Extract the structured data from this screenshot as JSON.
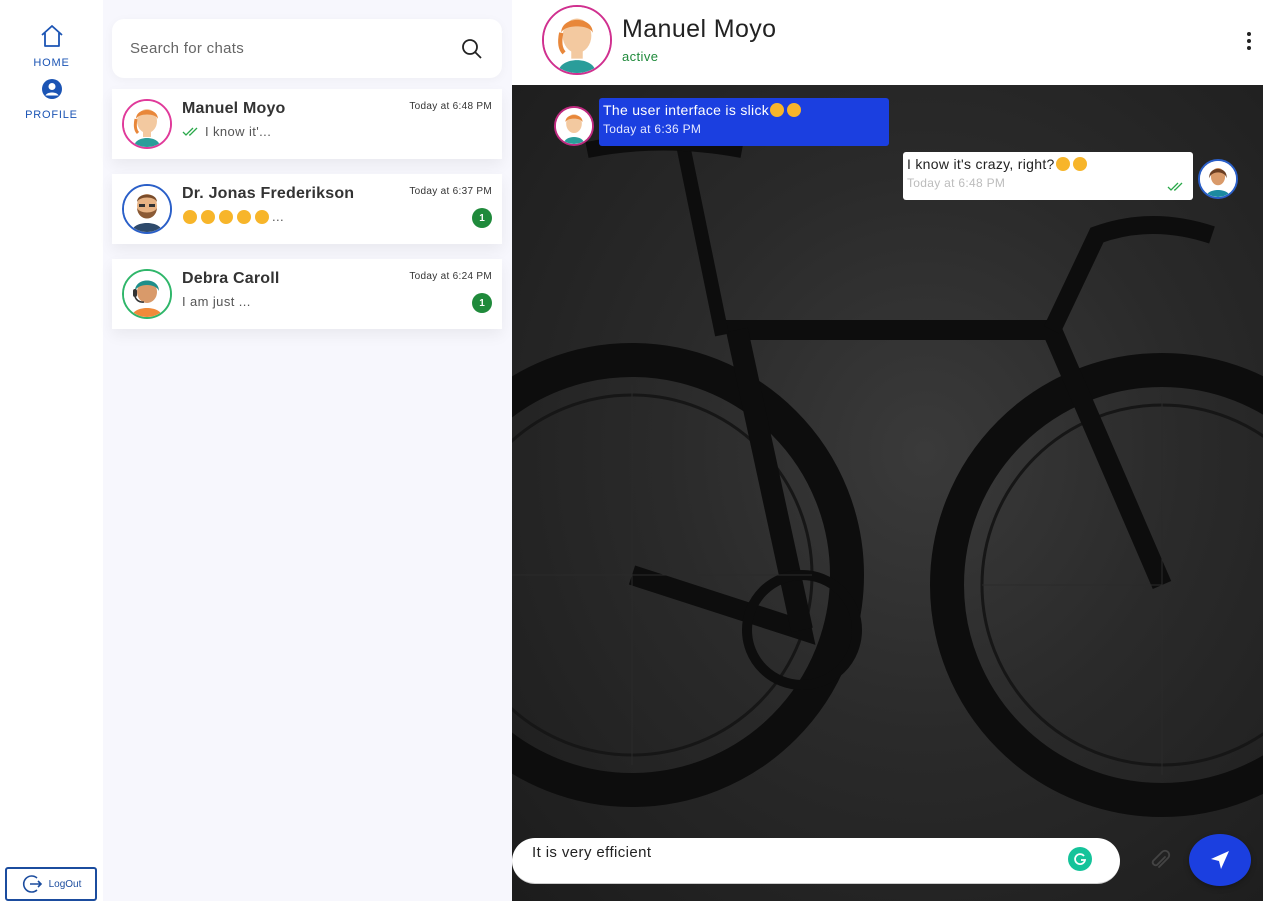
{
  "nav": {
    "home_label": "HOME",
    "profile_label": "PROFILE",
    "logout_label": "LogOut"
  },
  "search": {
    "placeholder": "Search for chats"
  },
  "chats": [
    {
      "name": "Manuel Moyo",
      "preview": "I know it'...",
      "time": "Today at 6:48 PM",
      "read": true
    },
    {
      "name": "Dr. Jonas Frederikson",
      "preview": "...",
      "emoji_count": 5,
      "time": "Today at 6:37 PM",
      "unread": "1"
    },
    {
      "name": "Debra Caroll",
      "preview": "I am just ...",
      "time": "Today at 6:24 PM",
      "unread": "1"
    }
  ],
  "conversation": {
    "contact_name": "Manuel Moyo",
    "status": "active",
    "messages": [
      {
        "direction": "incoming",
        "text": "The user interface is slick",
        "emojis": [
          "star-struck",
          "star-struck"
        ],
        "time": "Today at 6:36 PM"
      },
      {
        "direction": "outgoing",
        "text": "I know it's crazy, right?",
        "emojis": [
          "sunglasses",
          "smirk"
        ],
        "time": "Today at 6:48 PM",
        "read": true
      }
    ],
    "composer_value": "It is very efficient"
  },
  "colors": {
    "accent": "#1b3fe0",
    "nav": "#1b54b4",
    "online": "#1f8a3b",
    "badge": "#1f8a3b"
  }
}
